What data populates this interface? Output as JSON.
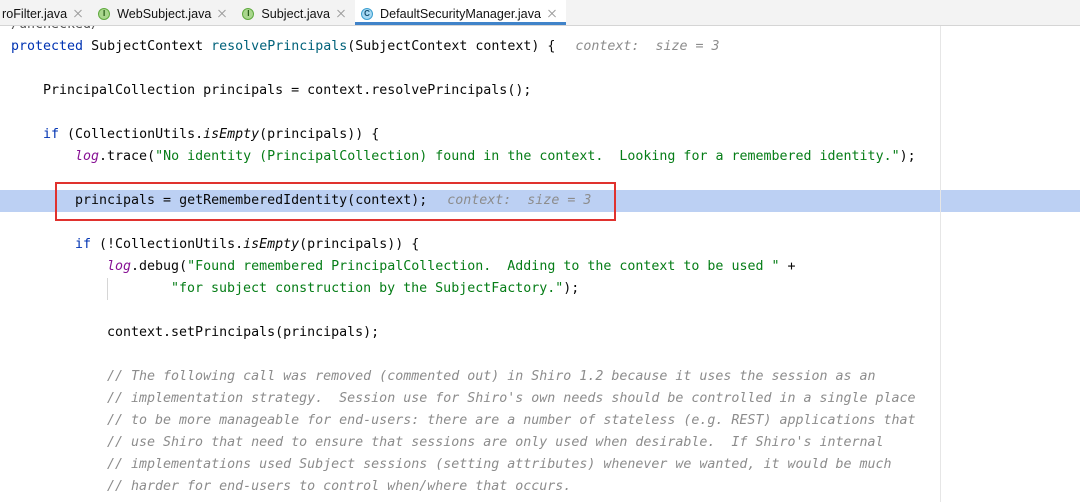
{
  "tabs": [
    {
      "label": "roFilter.java"
    },
    {
      "label": "WebSubject.java",
      "icon": "interface-icon",
      "icon_letter": "I"
    },
    {
      "label": "Subject.java",
      "icon": "interface-icon",
      "icon_letter": "I"
    },
    {
      "label": "DefaultSecurityManager.java",
      "icon": "class-icon",
      "icon_letter": "C",
      "active": true
    }
  ],
  "icons": {
    "close": "close-icon"
  },
  "editor": {
    "lines": [
      {
        "tokens": [
          "/unchecked/"
        ]
      },
      {
        "tokens": [
          "protected",
          " SubjectContext ",
          "resolvePrincipals",
          "(SubjectContext context) {"
        ],
        "hint": "context:  size = 3"
      },
      {
        "tokens": [
          "PrincipalCollection principals = context.resolvePrincipals();"
        ]
      },
      {
        "tokens": [
          "if",
          " (CollectionUtils.",
          "isEmpty",
          "(principals)) {"
        ]
      },
      {
        "tokens": [
          "log",
          ".trace(",
          "\"No identity (PrincipalCollection) found in the context.  Looking for a remembered identity.\"",
          ");"
        ]
      },
      {
        "tokens": [
          "principals = getRememberedIdentity(context);"
        ],
        "hint": "context:  size = 3"
      },
      {
        "tokens": [
          "if",
          " (!CollectionUtils.",
          "isEmpty",
          "(principals)) {"
        ]
      },
      {
        "tokens": [
          "log",
          ".debug(",
          "\"Found remembered PrincipalCollection.  Adding to the context to be used \"",
          " +"
        ]
      },
      {
        "tokens": [
          "\"for subject construction by the SubjectFactory.\"",
          ");"
        ]
      },
      {
        "tokens": [
          "context.setPrincipals(principals);"
        ]
      },
      {
        "tokens": [
          "// The following call was removed (commented out) in Shiro 1.2 because it uses the session as an"
        ]
      },
      {
        "tokens": [
          "// implementation strategy.  Session use for Shiro's own needs should be controlled in a single place"
        ]
      },
      {
        "tokens": [
          "// to be more manageable for end-users: there are a number of stateless (e.g. REST) applications that"
        ]
      },
      {
        "tokens": [
          "// use Shiro that need to ensure that sessions are only used when desirable.  If Shiro's internal"
        ]
      },
      {
        "tokens": [
          "// implementations used Subject sessions (setting attributes) whenever we wanted, it would be much"
        ]
      },
      {
        "tokens": [
          "// harder for end-users to control when/where that occurs."
        ]
      }
    ]
  },
  "colors": {
    "keyword": "#0033b3",
    "string": "#067d17",
    "static_field": "#871094",
    "method_declaration": "#00627a",
    "comment": "#8c8c8c",
    "inline_hint": "#8c8c8c",
    "execution_line": "#bcd0f3",
    "annotation_box": "#e0322e",
    "tab_accent": "#4083c9"
  }
}
